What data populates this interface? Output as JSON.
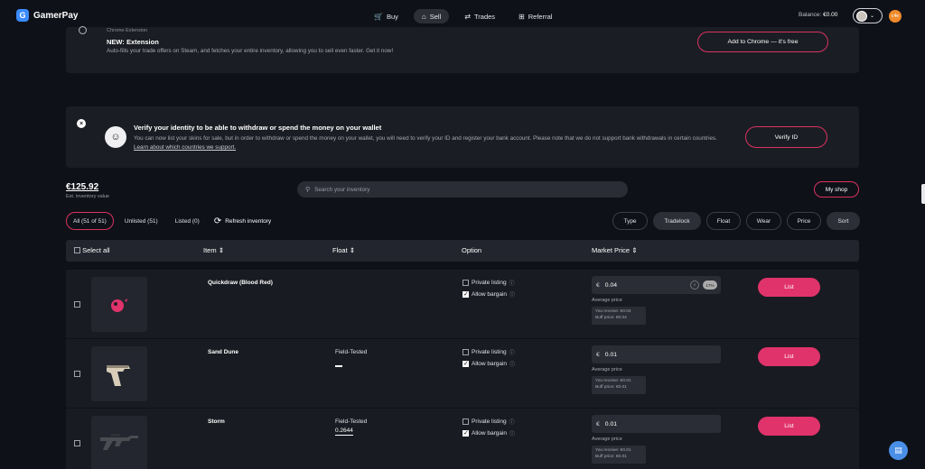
{
  "app": {
    "name": "GamerPay"
  },
  "nav": {
    "tabs": [
      {
        "label": "Buy",
        "icon": "cart-icon"
      },
      {
        "label": "Sell",
        "icon": "tag-icon",
        "active": true
      },
      {
        "label": "Trades",
        "icon": "swap-icon"
      },
      {
        "label": "Referral",
        "icon": "gift-icon"
      }
    ],
    "balance_label": "Balance:",
    "balance_value": "€0.00",
    "notification_badge": "c4e"
  },
  "extension_banner": {
    "overline": "Chrome Extension",
    "title": "NEW: Extension",
    "text": "Auto-fills your trade offers on Steam, and fetches your entire inventory, allowing you to sell even faster. Get it now!",
    "button": "Add to Chrome — it's free"
  },
  "verify_banner": {
    "title": "Verify your identity to be able to withdraw or spend the money on your wallet",
    "text": "You can now list your skins for sale, but in order to withdraw or spend the money on your wallet, you will need to verify your ID and register your bank account. Please note that we do not support bank withdrawals in certain countries.",
    "link": "Learn about which countries we support.",
    "button": "Verify ID"
  },
  "inventory": {
    "est_value": "€125.92",
    "est_label": "Est. inventory value",
    "search_placeholder": "Search your inventory",
    "myshop": "My shop",
    "filters": [
      {
        "label": "All (51 of 51)",
        "active": true
      },
      {
        "label": "Unlisted (51)"
      },
      {
        "label": "Listed (0)"
      }
    ],
    "refresh": "Refresh inventory",
    "sort_buttons": [
      "Type",
      "Tradelock",
      "Float",
      "Wear",
      "Price",
      "Sort"
    ]
  },
  "table": {
    "headers": {
      "select_all": "Select all",
      "item": "Item",
      "float": "Float",
      "option": "Option",
      "market_price": "Market Price"
    },
    "rows": [
      {
        "name": "Quickdraw (Blood Red)",
        "wear": "",
        "float": "",
        "private_listing": "Private listing",
        "allow_bargain": "Allow bargain",
        "currency": "€",
        "price": "0.04",
        "percent_badge": "17%",
        "avg_label": "Average price",
        "you_receive": "You receive: €0.04",
        "buff_price": "Buff price: €0.04",
        "list": "List"
      },
      {
        "name": "Sand Dune",
        "wear": "Field-Tested",
        "float": "",
        "private_listing": "Private listing",
        "allow_bargain": "Allow bargain",
        "currency": "€",
        "price": "0.01",
        "avg_label": "Average price",
        "you_receive": "You receive: €0.01",
        "buff_price": "Buff price: €0.01",
        "list": "List"
      },
      {
        "name": "Storm",
        "wear": "Field-Tested",
        "float": "0.2644",
        "private_listing": "Private listing",
        "allow_bargain": "Allow bargain",
        "currency": "€",
        "price": "0.01",
        "avg_label": "Average price",
        "you_receive": "You receive: €0.01",
        "buff_price": "Buff price: €0.01",
        "list": "List"
      }
    ]
  },
  "colors": {
    "accent": "#e0336b",
    "background": "#0f1118",
    "panel": "#1b1d24",
    "brand": "#3a8bff"
  }
}
